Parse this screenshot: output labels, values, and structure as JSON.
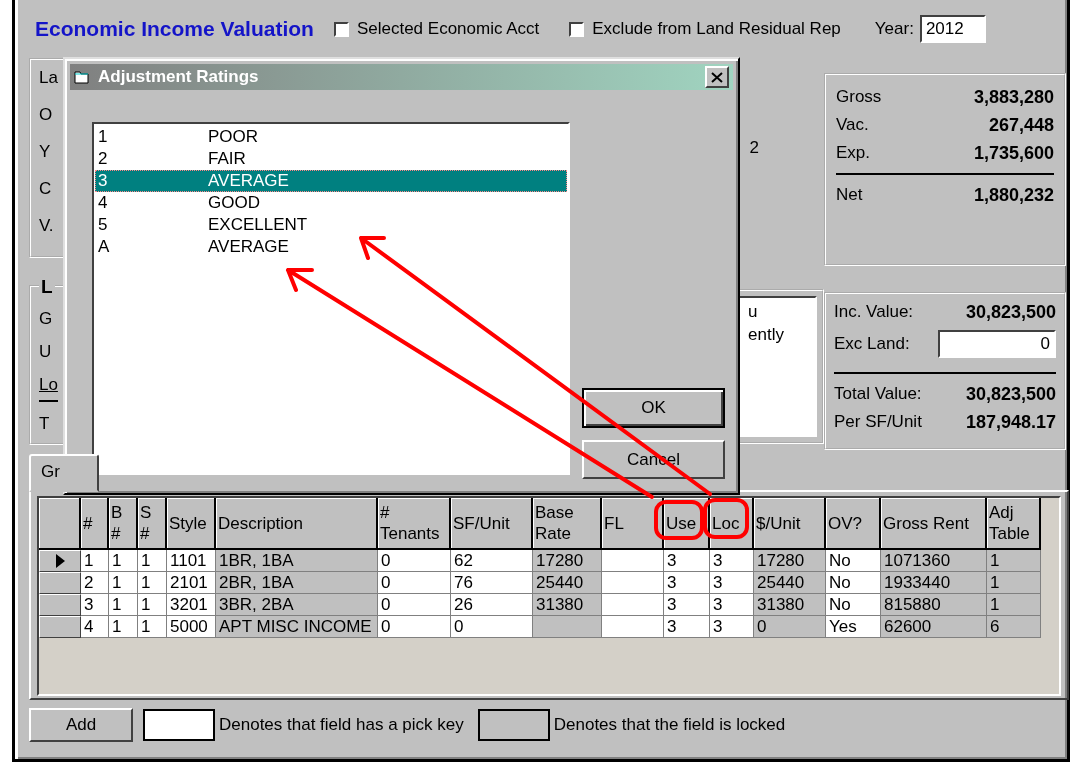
{
  "window": {
    "title": "Economic Income Valuation"
  },
  "header": {
    "checkboxes": [
      {
        "label": "Selected Economic Acct",
        "checked": false
      },
      {
        "label": "Exclude from Land Residual Rep",
        "checked": false
      }
    ],
    "year": {
      "label": "Year:",
      "value": "2012"
    }
  },
  "left_panel": {
    "labels": [
      "La",
      "O",
      "Y",
      "C",
      "V."
    ]
  },
  "partial_value": "2",
  "land_group": {
    "title": "L",
    "labels": [
      "G",
      "U",
      "Lo",
      "T"
    ]
  },
  "notes_box": {
    "lines": [
      "u",
      "ently"
    ]
  },
  "summary": {
    "rows": [
      {
        "label": "Gross",
        "value": "3,883,280"
      },
      {
        "label": "Vac.",
        "value": "267,448"
      },
      {
        "label": "Exp.",
        "value": "1,735,600"
      }
    ],
    "net": {
      "label": "Net",
      "value": "1,880,232"
    }
  },
  "values_panel": {
    "inc_value": {
      "label": "Inc. Value:",
      "value": "30,823,500"
    },
    "exc_land": {
      "label": "Exc Land:",
      "value": "0"
    },
    "total_value": {
      "label": "Total Value:",
      "value": "30,823,500"
    },
    "per_unit": {
      "label": "Per SF/Unit",
      "value": "187,948.17"
    }
  },
  "tabs": [
    {
      "label": "Gr",
      "selected": true
    }
  ],
  "grid": {
    "columns": [
      {
        "label": "#",
        "locked": false
      },
      {
        "label": "B\n#",
        "locked": false
      },
      {
        "label": "S\n#",
        "locked": false
      },
      {
        "label": "Style",
        "locked": false
      },
      {
        "label": "Description",
        "locked": true
      },
      {
        "label": "#\nTenants",
        "locked": false
      },
      {
        "label": "SF/Unit",
        "locked": false
      },
      {
        "label": "Base\nRate",
        "locked": true
      },
      {
        "label": "FL",
        "locked": false
      },
      {
        "label": "Use",
        "locked": false
      },
      {
        "label": "Loc",
        "locked": false
      },
      {
        "label": "$/Unit",
        "locked": true
      },
      {
        "label": "OV?",
        "locked": false
      },
      {
        "label": "Gross Rent",
        "locked": true
      },
      {
        "label": "Adj\nTable",
        "locked": true
      }
    ],
    "rows": [
      {
        "selected": true,
        "cells": [
          "1",
          "1",
          "1",
          "1101",
          "1BR, 1BA",
          "0",
          "62",
          "17280",
          null,
          "3",
          "3",
          "17280",
          "No",
          "1071360",
          "1"
        ]
      },
      {
        "selected": false,
        "cells": [
          "2",
          "1",
          "1",
          "2101",
          "2BR, 1BA",
          "0",
          "76",
          "25440",
          null,
          "3",
          "3",
          "25440",
          "No",
          "1933440",
          "1"
        ]
      },
      {
        "selected": false,
        "cells": [
          "3",
          "1",
          "1",
          "3201",
          "3BR, 2BA",
          "0",
          "26",
          "31380",
          null,
          "3",
          "3",
          "31380",
          "No",
          "815880",
          "1"
        ]
      },
      {
        "selected": false,
        "cells": [
          "4",
          "1",
          "1",
          "5000",
          "APT MISC INCOME",
          "0",
          "0",
          null,
          null,
          "3",
          "3",
          "0",
          "Yes",
          "62600",
          "6"
        ]
      }
    ]
  },
  "footer": {
    "add_button": "Add",
    "legend": [
      {
        "kind": "pick",
        "text": "Denotes that field has a pick key"
      },
      {
        "kind": "locked",
        "text": "Denotes that the field is locked"
      }
    ]
  },
  "dialog": {
    "title": "Adjustment Ratings",
    "items": [
      {
        "code": "1",
        "label": "POOR",
        "selected": false
      },
      {
        "code": "2",
        "label": "FAIR",
        "selected": false
      },
      {
        "code": "3",
        "label": "AVERAGE",
        "selected": true
      },
      {
        "code": "4",
        "label": "GOOD",
        "selected": false
      },
      {
        "code": "5",
        "label": "EXCELLENT",
        "selected": false
      },
      {
        "code": "A",
        "label": "AVERAGE",
        "selected": false
      }
    ],
    "buttons": [
      "OK",
      "Cancel"
    ]
  }
}
